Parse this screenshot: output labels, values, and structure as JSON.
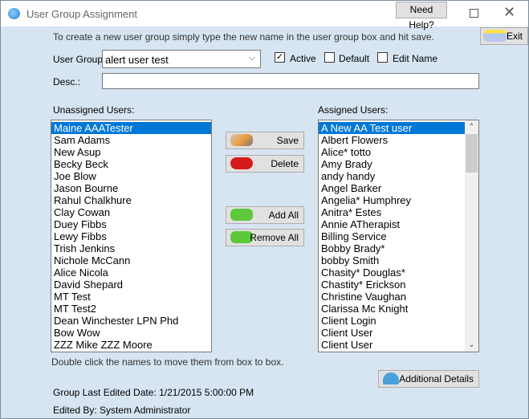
{
  "window": {
    "title": "User Group Assignment",
    "help_label": "Need Help?"
  },
  "exit_label": "Exit",
  "instructions": "To create a new user group simply type the new name in the user group box and hit save.",
  "user_group": {
    "label": "User Group:",
    "value": "alert user test"
  },
  "checkboxes": {
    "active": {
      "label": "Active",
      "checked": true
    },
    "default": {
      "label": "Default",
      "checked": false
    },
    "edit_name": {
      "label": "Edit Name",
      "checked": false
    }
  },
  "desc": {
    "label": "Desc.:",
    "value": ""
  },
  "unassigned": {
    "label": "Unassigned Users:",
    "items": [
      "Maine AAATester",
      "Sam  Adams",
      "New Asup",
      "Becky Beck",
      "Joe Blow",
      "Jason Bourne",
      "Rahul Chalkhure",
      "Clay Cowan",
      "Duey Fibbs",
      "Lewy Fibbs",
      "Trish Jenkins",
      "Nichole McCann",
      "Alice Nicola",
      "David Shepard",
      "MT Test",
      "MT Test2",
      "Dean Winchester LPN Phd",
      "Bow Wow",
      "ZZZ Mike ZZZ Moore"
    ]
  },
  "assigned": {
    "label": "Assigned Users:",
    "items": [
      "A New AA Test user",
      "Albert Flowers",
      "Alice* totto",
      "Amy Brady",
      "andy handy",
      "Angel  Barker",
      "Angelia* Humphrey",
      "Anitra* Estes",
      "Annie  ATherapist",
      "Billing Service",
      "Bobby  Brady*",
      "bobby Smith",
      "Chasity* Douglas*",
      "Chastity* Erickson",
      "Christine Vaughan",
      "Clarissa Mc Knight",
      "Client Login",
      "Client User",
      "Client User"
    ]
  },
  "buttons": {
    "save": "Save",
    "delete": "Delete",
    "add_all": "Add All",
    "remove_all": "Remove All",
    "additional_details": "Additional Details"
  },
  "hint": "Double click the names to move them from box to box.",
  "last_edited": "Group Last Edited Date: 1/21/2015 5:00:00 PM",
  "edited_by": "Edited By: System Administrator",
  "colors": {
    "background": "#d7e4f2",
    "selection": "#0078d7"
  }
}
